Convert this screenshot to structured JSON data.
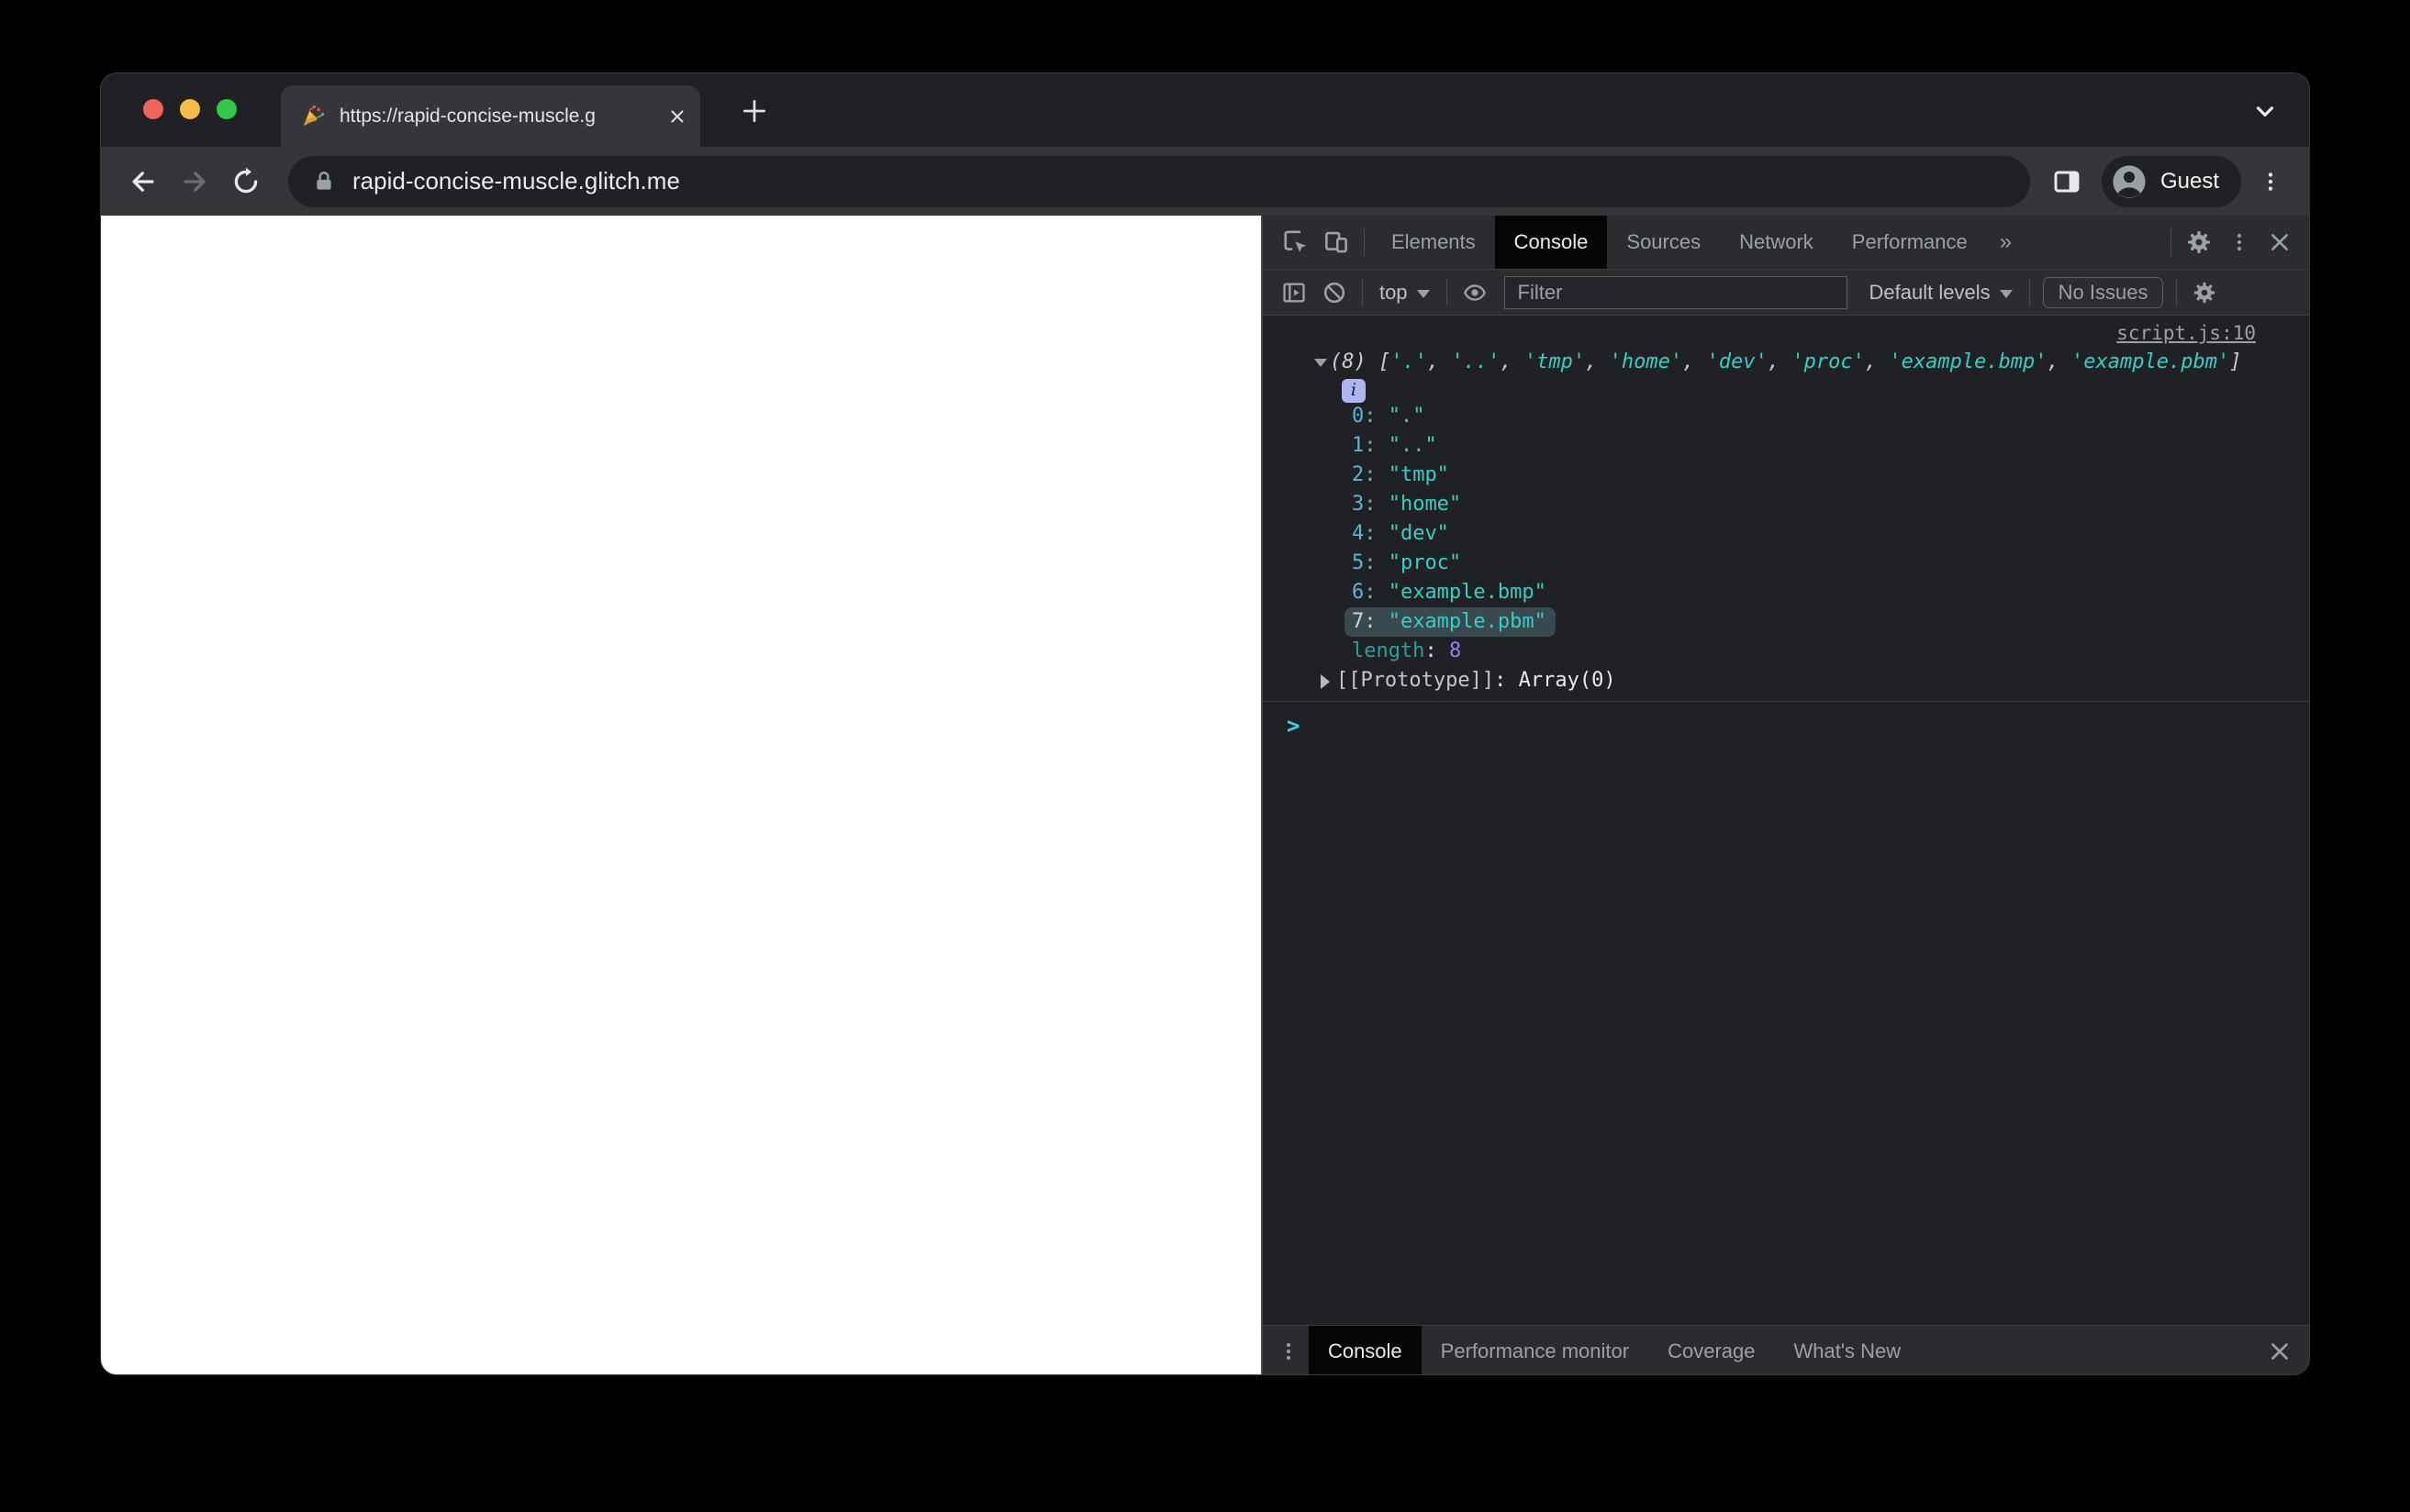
{
  "browser": {
    "tab_title": "https://rapid-concise-muscle.g",
    "url": "rapid-concise-muscle.glitch.me",
    "profile_label": "Guest"
  },
  "devtools": {
    "tabs": [
      "Elements",
      "Console",
      "Sources",
      "Network",
      "Performance"
    ],
    "active_tab": "Console",
    "overflow_symbol": "»",
    "toolbar": {
      "context_selector": "top",
      "filter_placeholder": "Filter",
      "levels_selector": "Default levels",
      "issues_button": "No Issues"
    },
    "console": {
      "source_link": "script.js:10",
      "preview_prefix": "(8)",
      "items": [
        ".",
        "..",
        "tmp",
        "home",
        "dev",
        "proc",
        "example.bmp",
        "example.pbm"
      ],
      "highlighted_index": 7,
      "length_label": "length",
      "length_value": "8",
      "prototype_label": "[[Prototype]]",
      "prototype_value": "Array(0)",
      "prompt_symbol": ">"
    },
    "drawer": {
      "tabs": [
        "Console",
        "Performance monitor",
        "Coverage",
        "What's New"
      ],
      "active_tab": "Console"
    }
  },
  "colors": {
    "string": "#35cfc5",
    "index": "#5db3d8",
    "number": "#9a7fea",
    "dim_teal": "#2aa198",
    "punctuation": "#c9ccce",
    "highlight_bg": "#38494f",
    "prompt": "#3fd3e0",
    "info_badge_bg": "#aeb5f0",
    "traffic_red": "#f4635a",
    "traffic_yellow": "#f5bd45",
    "traffic_green": "#31c748"
  }
}
